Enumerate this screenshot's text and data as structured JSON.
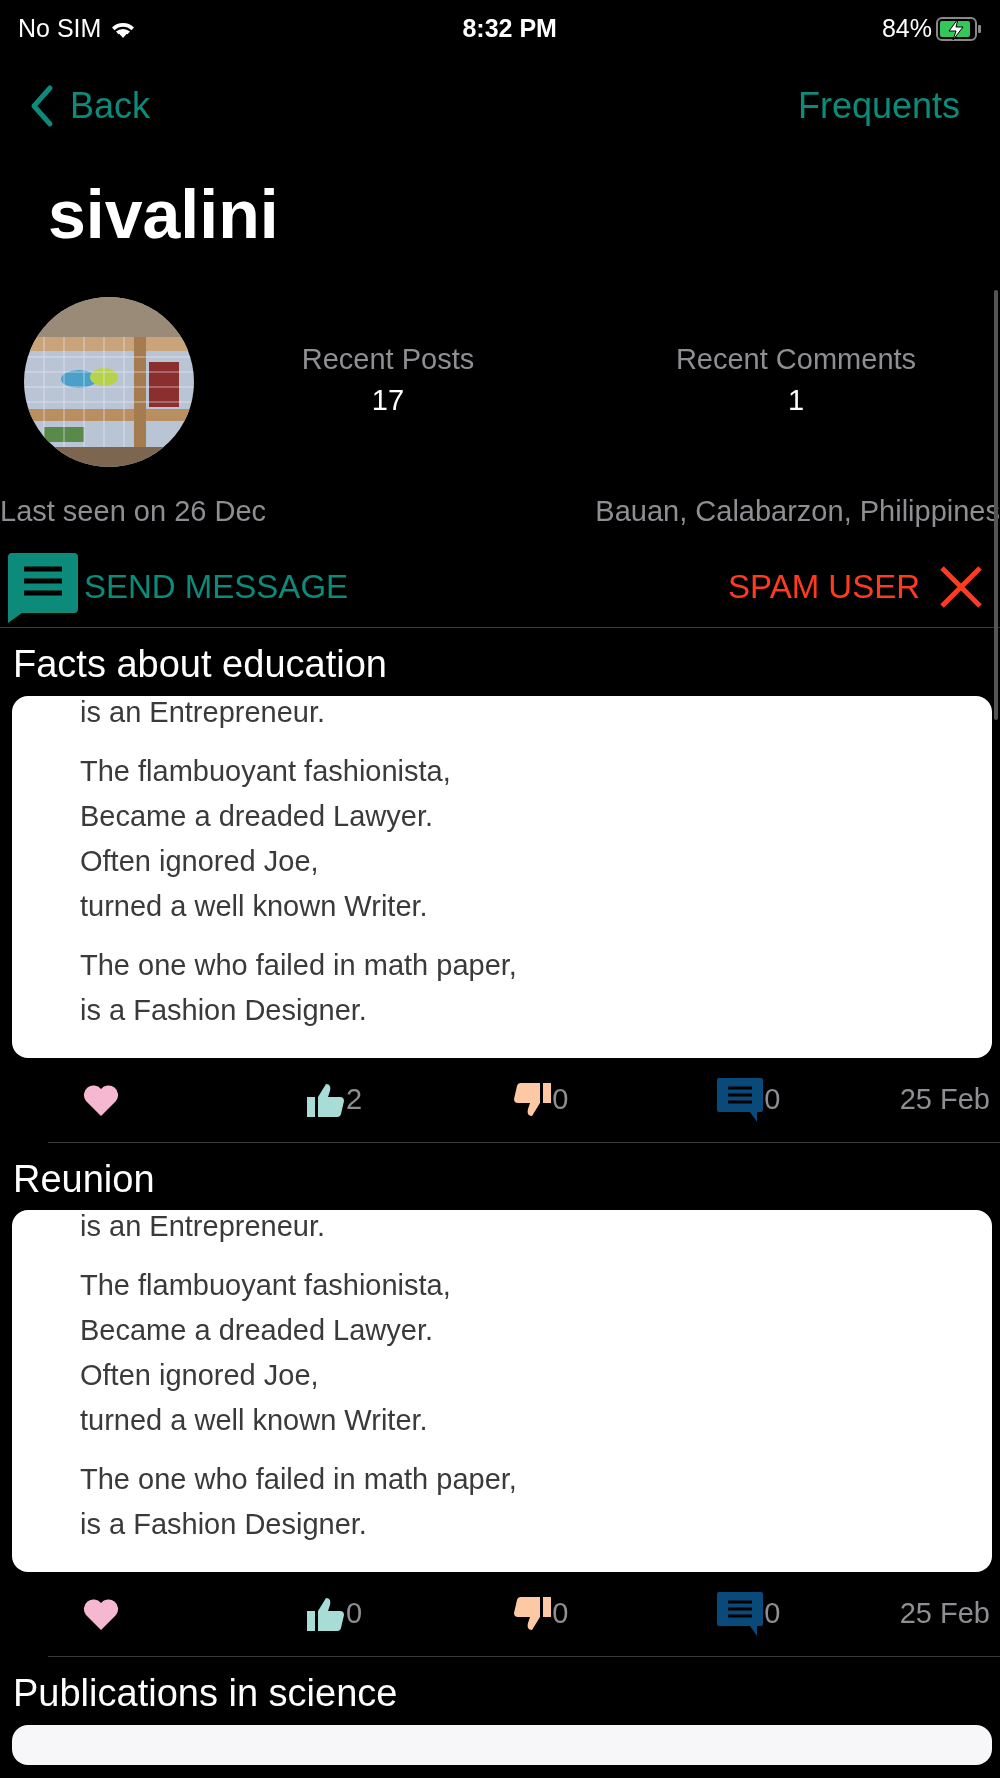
{
  "status_bar": {
    "carrier": "No SIM",
    "time": "8:32 PM",
    "battery": "84%",
    "charging": true
  },
  "nav": {
    "back": "Back",
    "right": "Frequents"
  },
  "profile": {
    "name": "sivalini",
    "stats": [
      {
        "label": "Recent Posts",
        "value": "17"
      },
      {
        "label": "Recent Comments",
        "value": "1"
      }
    ],
    "last_seen": "Last seen on 26 Dec",
    "location": "Bauan, Calabarzon, Philippines",
    "send_message": "SEND MESSAGE",
    "spam_user": "SPAM USER"
  },
  "posts": [
    {
      "title": "Facts about education",
      "stanzas": [
        [
          "is an Entrepreneur."
        ],
        [
          "The flambuoyant fashionista,",
          "Became a dreaded Lawyer.",
          "Often ignored Joe,",
          "turned a well known Writer."
        ],
        [
          "The one who failed in math paper,",
          "is a Fashion Designer."
        ]
      ],
      "likes": "2",
      "dislikes": "0",
      "comments": "0",
      "date": "25 Feb"
    },
    {
      "title": "Reunion",
      "stanzas": [
        [
          "is an Entrepreneur."
        ],
        [
          "The flambuoyant fashionista,",
          "Became a dreaded Lawyer.",
          "Often ignored Joe,",
          "turned a well known Writer."
        ],
        [
          "The one who failed in math paper,",
          "is a Fashion Designer."
        ]
      ],
      "likes": "0",
      "dislikes": "0",
      "comments": "0",
      "date": "25 Feb"
    },
    {
      "title": "Publications in science"
    }
  ]
}
